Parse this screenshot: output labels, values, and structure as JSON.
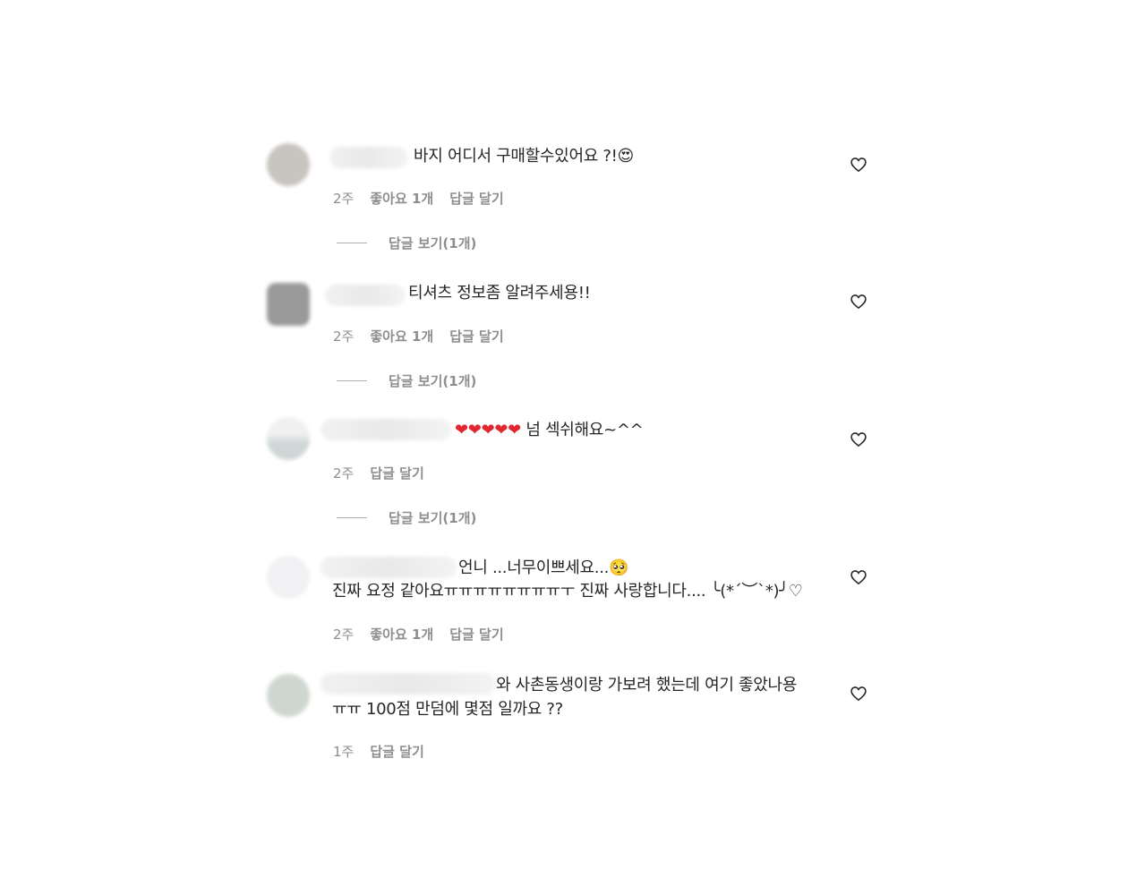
{
  "comments": [
    {
      "text": "바지 어디서 구매할수있어요 ?!😍",
      "time": "2주",
      "likes": "좋아요 1개",
      "reply": "답글 달기",
      "view_replies": "답글 보기(1개)",
      "avatar_color": "#c8c4c0"
    },
    {
      "text": "티셔츠 정보좀 알려주세용!!",
      "time": "2주",
      "likes": "좋아요 1개",
      "reply": "답글 달기",
      "view_replies": "답글 보기(1개)",
      "avatar_color": "#9a9a9a"
    },
    {
      "text": "❤️❤️❤️❤️❤️ 넘 섹쉬해요~^^",
      "time": "2주",
      "reply": "답글 달기",
      "view_replies": "답글 보기(1개)",
      "avatar_color": "#dde2e2"
    },
    {
      "text_line1": "언니 ...너무이쁘세요...🥺",
      "text_line2": "진짜 요정 같아요ㅠㅠㅠㅠㅠㅠㅠㅠㅜ 진짜 사랑합니다.... ╰(*´︶`*)╯♡",
      "time": "2주",
      "likes": "좋아요 1개",
      "reply": "답글 달기",
      "avatar_color": "#f4f4f6"
    },
    {
      "text_line1": "와 사촌동생이랑 가보려 했는데 여기 좋았나용",
      "text_line2": "ㅠㅠ 100점 만덤에 몇점 일까요 ??",
      "time": "1주",
      "reply": "답글 달기",
      "avatar_color": "#cfd6cf"
    }
  ],
  "icons": {
    "like": "heart-outline-icon"
  }
}
